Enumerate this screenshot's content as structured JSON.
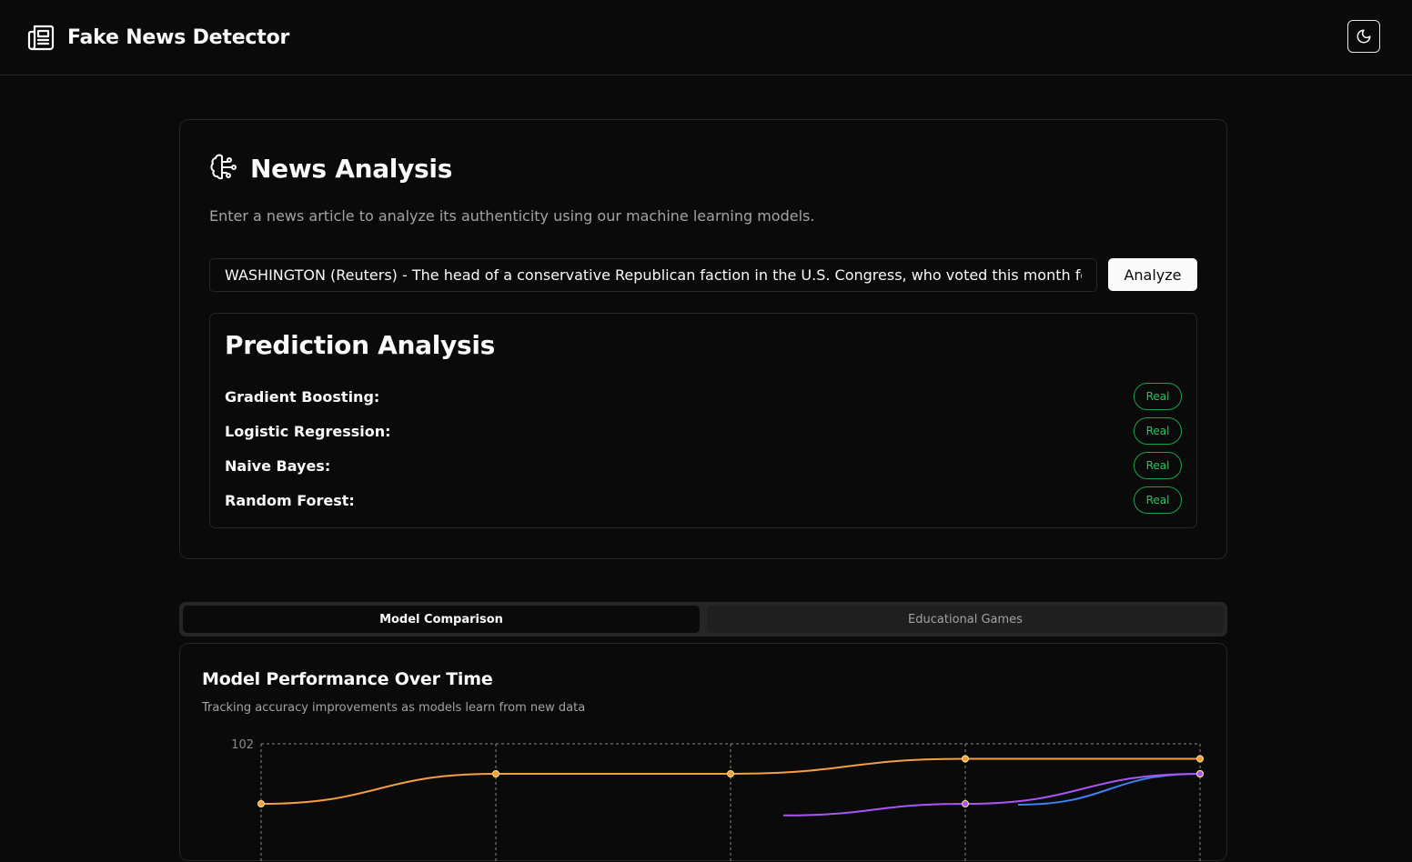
{
  "header": {
    "app_title": "Fake News Detector",
    "logo_icon": "newspaper-icon",
    "theme_toggle_icon": "moon-icon"
  },
  "analysis": {
    "icon": "brain-icon",
    "title": "News Analysis",
    "description": "Enter a news article to analyze its authenticity using our machine learning models.",
    "input_value": "WASHINGTON (Reuters) - The head of a conservative Republican faction in the U.S. Congress, who voted this month for",
    "analyze_label": "Analyze"
  },
  "prediction": {
    "title": "Prediction Analysis",
    "rows": [
      {
        "model": "Gradient Boosting:",
        "result": "Real"
      },
      {
        "model": "Logistic Regression:",
        "result": "Real"
      },
      {
        "model": "Naive Bayes:",
        "result": "Real"
      },
      {
        "model": "Random Forest:",
        "result": "Real"
      }
    ],
    "real_color": "#22c55e"
  },
  "tabs": [
    {
      "label": "Model Comparison",
      "active": true
    },
    {
      "label": "Educational Games",
      "active": false
    }
  ],
  "performance": {
    "title": "Model Performance Over Time",
    "subtitle": "Tracking accuracy improvements as models learn from new data"
  },
  "chart_data": {
    "type": "line",
    "title": "Model Performance Over Time",
    "subtitle": "Tracking accuracy improvements as models learn from new data",
    "y_tick_labels": [
      "102"
    ],
    "grid": true,
    "visible_y_range": [
      100,
      102
    ],
    "point_count": 5,
    "series": [
      {
        "color": "#f59e42",
        "values": [
          100,
          101,
          101,
          101.5,
          101.5
        ]
      },
      {
        "color": "#a855f7",
        "values": [
          null,
          null,
          null,
          100,
          101
        ]
      },
      {
        "color": "#3b82f6",
        "values": [
          null,
          null,
          null,
          null,
          101
        ]
      }
    ]
  }
}
